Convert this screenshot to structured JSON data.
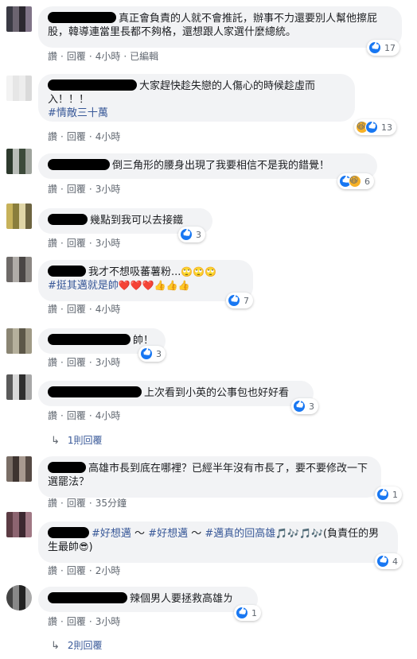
{
  "labels": {
    "like": "讚",
    "reply": "回覆",
    "sep": "·"
  },
  "comments": [
    {
      "text": "真正會負責的人就不會推託，辦事不力還要別人幫他擦屁股，韓導連當里長都不夠格，還想跟人家選什麼總統。",
      "reactions": "17",
      "time": "4小時",
      "edited": "已編輯",
      "avatar": [
        "#3a3a44",
        "#6b6470",
        "#2c2830",
        "#807488"
      ]
    },
    {
      "text": "大家趕快趁失戀的人傷心的時候趁虛而入！！！",
      "tag": "#情敵三十萬",
      "reactions": "13",
      "time": "4小時",
      "avatar": [
        "#f3f3f3",
        "#e6e6e6",
        "#ededed",
        "#dadada"
      ]
    },
    {
      "text": "倒三角形的腰身出現了我要相信不是我的錯覺！",
      "reactions": "6",
      "time": "3小時",
      "avatar": [
        "#2d3a2d",
        "#b9bdb8",
        "#3c4a3a",
        "#9fa49d"
      ]
    },
    {
      "text": "幾點到我可以去接鐵",
      "reactions": "3",
      "time": "3小時",
      "avatar": [
        "#c7b25a",
        "#8a7e3c",
        "#e0d6a8",
        "#6d6440"
      ]
    },
    {
      "text": "我才不想吸蕃薯粉...",
      "emoji1": "🙄🙄🙄",
      "tag": "#挺其邁就是帥",
      "emoji2": "❤️❤️❤️👍👍👍",
      "reactions": "7",
      "time": "4小時",
      "avatar": [
        "#6e6a68",
        "#b0aca8",
        "#4a4645",
        "#8c8884"
      ]
    },
    {
      "text": "帥！",
      "reactions": "3",
      "time": "3小時",
      "avatar": [
        "#8a8573",
        "#b5b09c",
        "#5c5748",
        "#a09a86"
      ]
    },
    {
      "text": "上次看到小英的公事包也好好看",
      "reactions": "3",
      "time": "4小時",
      "replies": "1則回覆",
      "avatar": [
        "#5a5a5a",
        "#d9d9d9",
        "#2e2e2e",
        "#a8a8a8"
      ]
    },
    {
      "text": "高雄市長到底在哪裡？已經半年沒有市長了，要不要修改一下選罷法？",
      "reactions": "1",
      "time": "35分鐘",
      "avatar": [
        "#7a6e66",
        "#3e3430",
        "#a89a90",
        "#564a44"
      ]
    },
    {
      "tag1": "#好想邁",
      "mid1": " ～ ",
      "tag2": "#好想邁",
      "mid2": " ～ ",
      "tag3": "#邁真的回高雄",
      "emoji1": "🎵🎶🎵🎶",
      "text": "(負責任的男生最帥",
      "emoji2": "😎",
      "tail": ")",
      "reactions": "4",
      "time": "2小時",
      "avatar": [
        "#5c3c44",
        "#8c6470",
        "#3c2830",
        "#a07884"
      ]
    },
    {
      "text": "辣個男人要拯救高雄ㄌ",
      "reactions": "1",
      "time": "3小時",
      "replies": "2則回覆",
      "avatar": [
        "#444",
        "#888",
        "#222",
        "#aaa"
      ]
    }
  ]
}
